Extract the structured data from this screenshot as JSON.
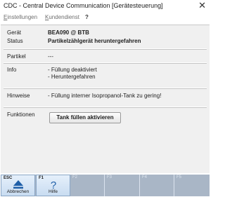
{
  "window": {
    "title": "CDC - Central Device Communication [Gerätesteuerung]",
    "close_glyph": "✕"
  },
  "menu": [
    {
      "first": "E",
      "rest": "instellungen"
    },
    {
      "first": "K",
      "rest": "undendienst"
    },
    {
      "first": "",
      "rest": "?"
    }
  ],
  "device": {
    "geraet_label": "Gerät",
    "geraet_value": "BEA090 @ BTB",
    "status_label": "Status",
    "status_value": "Partikelzählgerät heruntergefahren",
    "partikel_label": "Partikel",
    "partikel_value": "---",
    "info_label": "Info",
    "info_items": [
      "- Füllung deaktiviert",
      "- Heruntergefahren"
    ],
    "hinweise_label": "Hinweise",
    "hinweise_value": "- Füllung interner Isopropanol-Tank zu gering!",
    "funktionen_label": "Funktionen",
    "tank_button": "Tank füllen aktivieren"
  },
  "fkeys": [
    {
      "key": "ESC",
      "caption": "Abbrechen",
      "icon": "eject-triangle-icon",
      "enabled": true
    },
    {
      "key": "F1",
      "caption": "Hilfe",
      "icon": "question-mark-icon",
      "enabled": true
    },
    {
      "key": "F2",
      "caption": "",
      "enabled": false
    },
    {
      "key": "F3",
      "caption": "",
      "enabled": false
    },
    {
      "key": "F4",
      "caption": "",
      "enabled": false
    },
    {
      "key": "F5",
      "caption": "",
      "enabled": false
    }
  ],
  "colors": {
    "panel": "#f0f0f0",
    "fkey_bar": "#a9b6c6",
    "fkey_active": "#c9dcf1",
    "icon_blue": "#1f5fa8"
  }
}
